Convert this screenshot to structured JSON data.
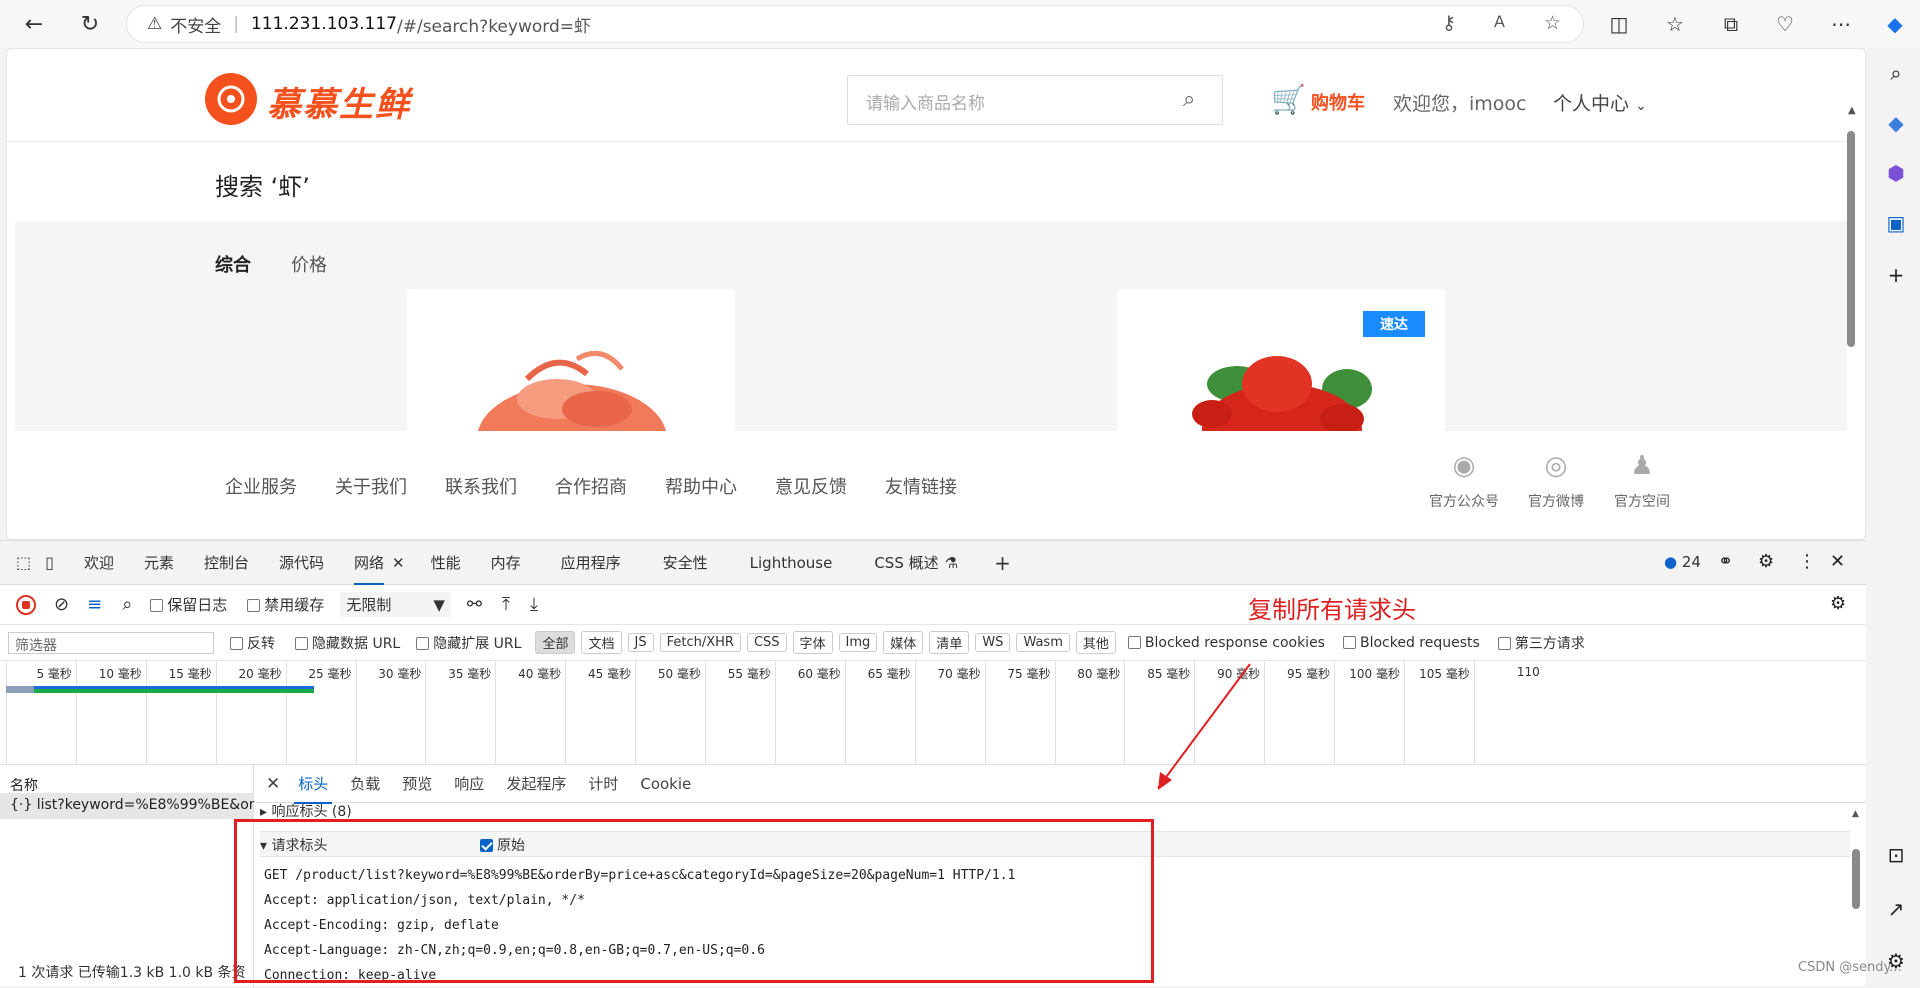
{
  "browser": {
    "insecure_label": "不安全",
    "url_host": "111.231.103.117",
    "url_path": "/#/search?keyword=虾",
    "icons": [
      "back-icon",
      "refresh-icon",
      "warning-icon",
      "key-icon",
      "read-aloud-icon",
      "favorite-icon",
      "split-screen-icon",
      "favorites-list-icon",
      "collections-icon",
      "health-icon",
      "more-icon",
      "copilot-icon"
    ]
  },
  "site": {
    "logo_text": "慕慕生鲜",
    "search_placeholder": "请输入商品名称",
    "cart_label": "购物车",
    "welcome": "欢迎您，imooc",
    "user_center": "个人中心",
    "search_title": "搜索 ‘虾’",
    "sort_all": "综合",
    "sort_price": "价格",
    "badge": "速达",
    "footer_links": [
      "企业服务",
      "关于我们",
      "联系我们",
      "合作招商",
      "帮助中心",
      "意见反馈",
      "友情链接"
    ],
    "social": [
      "官方公众号",
      "官方微博",
      "官方空间"
    ]
  },
  "devtools": {
    "tabs": [
      "欢迎",
      "元素",
      "控制台",
      "源代码",
      "网络",
      "性能",
      "内存",
      "应用程序",
      "安全性",
      "Lighthouse",
      "CSS 概述"
    ],
    "issues_count": "24",
    "toolbar": {
      "preserve_log": "保留日志",
      "disable_cache": "禁用缓存",
      "throttle": "无限制"
    },
    "filter_placeholder": "筛选器",
    "filter": {
      "invert": "反转",
      "hide_data_url": "隐藏数据 URL",
      "hide_ext_url": "隐藏扩展 URL",
      "types": [
        "全部",
        "文档",
        "JS",
        "Fetch/XHR",
        "CSS",
        "字体",
        "Img",
        "媒体",
        "清单",
        "WS",
        "Wasm",
        "其他"
      ],
      "blocked_cookies": "Blocked response cookies",
      "blocked_requests": "Blocked requests",
      "third_party": "第三方请求"
    },
    "timeline_ticks": [
      "5 毫秒",
      "10 毫秒",
      "15 毫秒",
      "20 毫秒",
      "25 毫秒",
      "30 毫秒",
      "35 毫秒",
      "40 毫秒",
      "45 毫秒",
      "50 毫秒",
      "55 毫秒",
      "60 毫秒",
      "65 毫秒",
      "70 毫秒",
      "75 毫秒",
      "80 毫秒",
      "85 毫秒",
      "90 毫秒",
      "95 毫秒",
      "100 毫秒",
      "105 毫秒",
      "110"
    ],
    "name_header": "名称",
    "request_name": "list?keyword=%E8%99%BE&or...",
    "detail_tabs": [
      "标头",
      "负载",
      "预览",
      "响应",
      "发起程序",
      "计时",
      "Cookie"
    ],
    "response_headers": "响应标头 (8)",
    "request_headers": "请求标头",
    "raw_label": "原始",
    "raw_lines": [
      "GET /product/list?keyword=%E8%99%BE&orderBy=price+asc&categoryId=&pageSize=20&pageNum=1 HTTP/1.1",
      "Accept: application/json, text/plain, */*",
      "Accept-Encoding: gzip, deflate",
      "Accept-Language: zh-CN,zh;q=0.9,en;q=0.8,en-GB;q=0.7,en-US;q=0.6",
      "Connection: keep-alive"
    ],
    "status": "1 次请求  已传输1.3 kB  1.0 kB 条资"
  },
  "annotation": {
    "label": "复制所有请求头",
    "color": "#e02020"
  },
  "watermark": "CSDN @sendy..."
}
